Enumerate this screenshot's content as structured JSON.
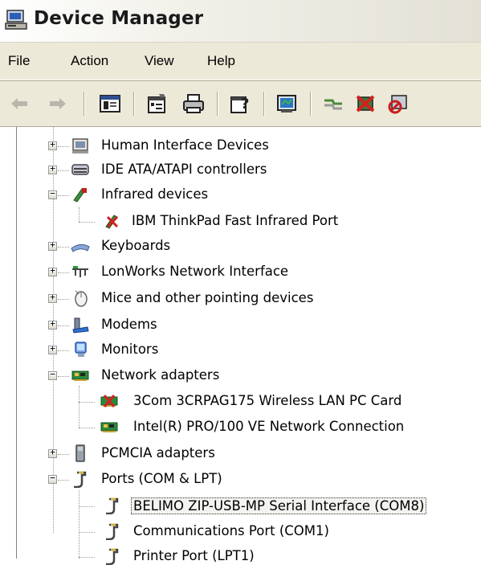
{
  "window": {
    "title": "Device Manager"
  },
  "menu": {
    "file": "File",
    "action": "Action",
    "view": "View",
    "help": "Help"
  },
  "toolbar": {
    "buttons": [
      "back-arrow-icon",
      "forward-arrow-icon",
      "show-hide-console-tree-icon",
      "properties-icon",
      "print-icon",
      "help-icon",
      "scan-hardware-icon",
      "update-driver-icon",
      "uninstall-icon",
      "disable-icon"
    ]
  },
  "tree": {
    "human_interface": "Human Interface Devices",
    "ide": "IDE ATA/ATAPI controllers",
    "infrared": "Infrared devices",
    "ibm_infrared": "IBM ThinkPad Fast Infrared Port",
    "keyboards": "Keyboards",
    "lonworks": "LonWorks Network Interface",
    "mice": "Mice and other pointing devices",
    "modems": "Modems",
    "monitors": "Monitors",
    "network": "Network adapters",
    "threecom": "3Com 3CRPAG175 Wireless LAN PC Card",
    "intel": "Intel(R) PRO/100 VE Network Connection",
    "pcmcia": "PCMCIA adapters",
    "ports": "Ports (COM & LPT)",
    "belimo": "BELIMO ZIP-USB-MP Serial Interface (COM8)",
    "comm_port": "Communications Port (COM1)",
    "printer_port": "Printer Port (LPT1)"
  }
}
